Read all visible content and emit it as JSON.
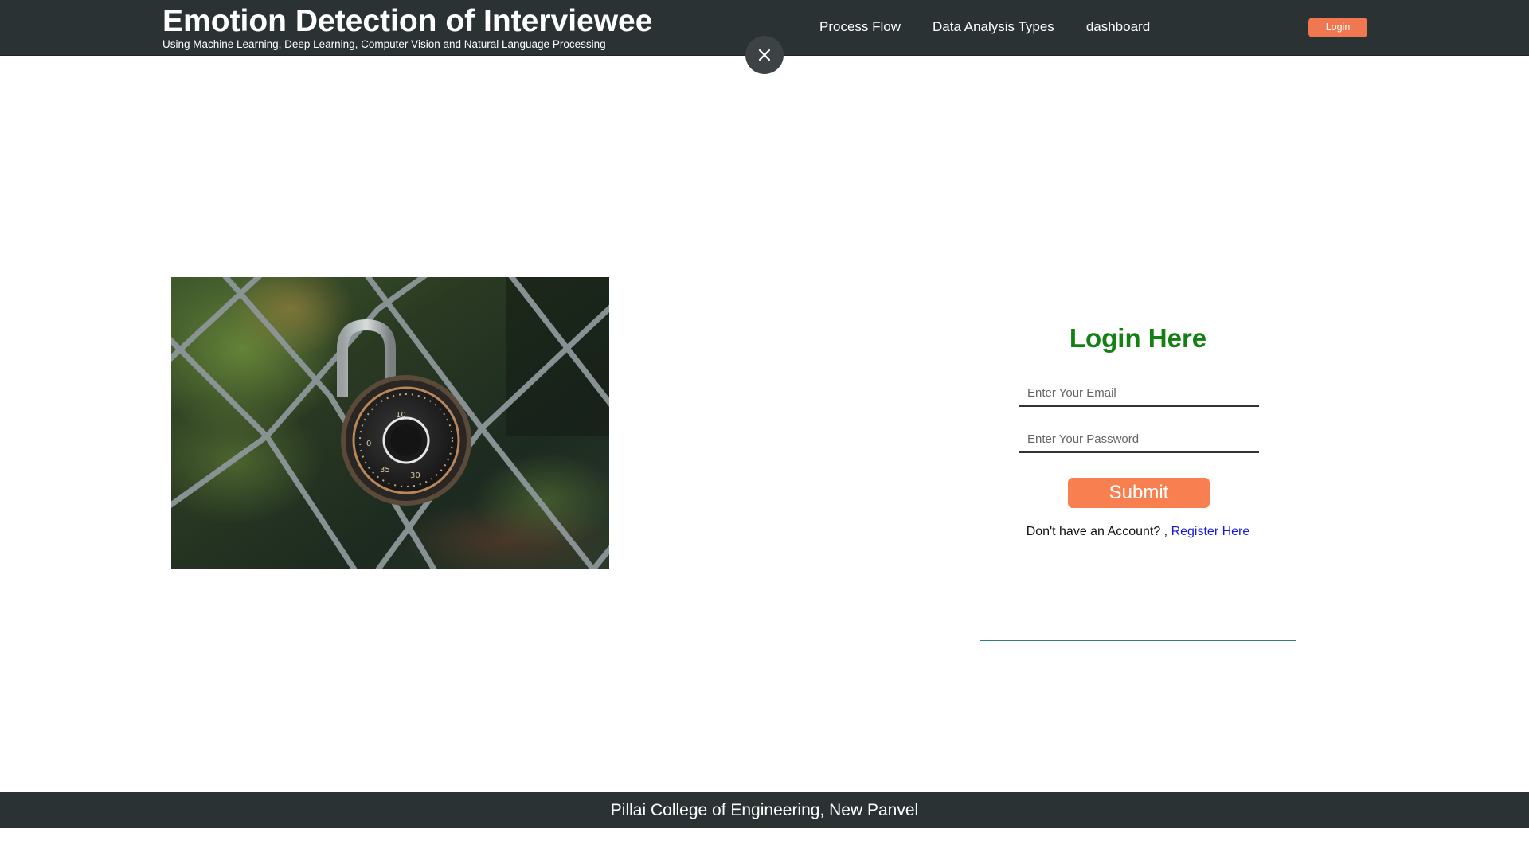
{
  "header": {
    "title": "Emotion Detection of Interviewee",
    "subtitle": "Using Machine Learning, Deep Learning, Computer Vision and Natural Language Processing",
    "nav": [
      {
        "label": "Process Flow"
      },
      {
        "label": "Data Analysis Types"
      },
      {
        "label": "dashboard"
      }
    ],
    "login_button": "Login"
  },
  "overlay": {
    "close_icon": "close-icon"
  },
  "hero": {
    "image_subject": "combination padlock on chain-link fence"
  },
  "login_form": {
    "heading": "Login Here",
    "email_placeholder": "Enter Your Email",
    "password_placeholder": "Enter Your Password",
    "submit_label": "Submit",
    "register_prompt": "Don't have an Account? ,",
    "register_link": "Register Here"
  },
  "footer": {
    "text": "Pillai College of Engineering, New Panvel"
  },
  "colors": {
    "navbar": "#2b3233",
    "accent": "#f77f50",
    "heading_green": "#138013",
    "card_border": "#2f7e80",
    "link_blue": "#1a1ad6"
  }
}
